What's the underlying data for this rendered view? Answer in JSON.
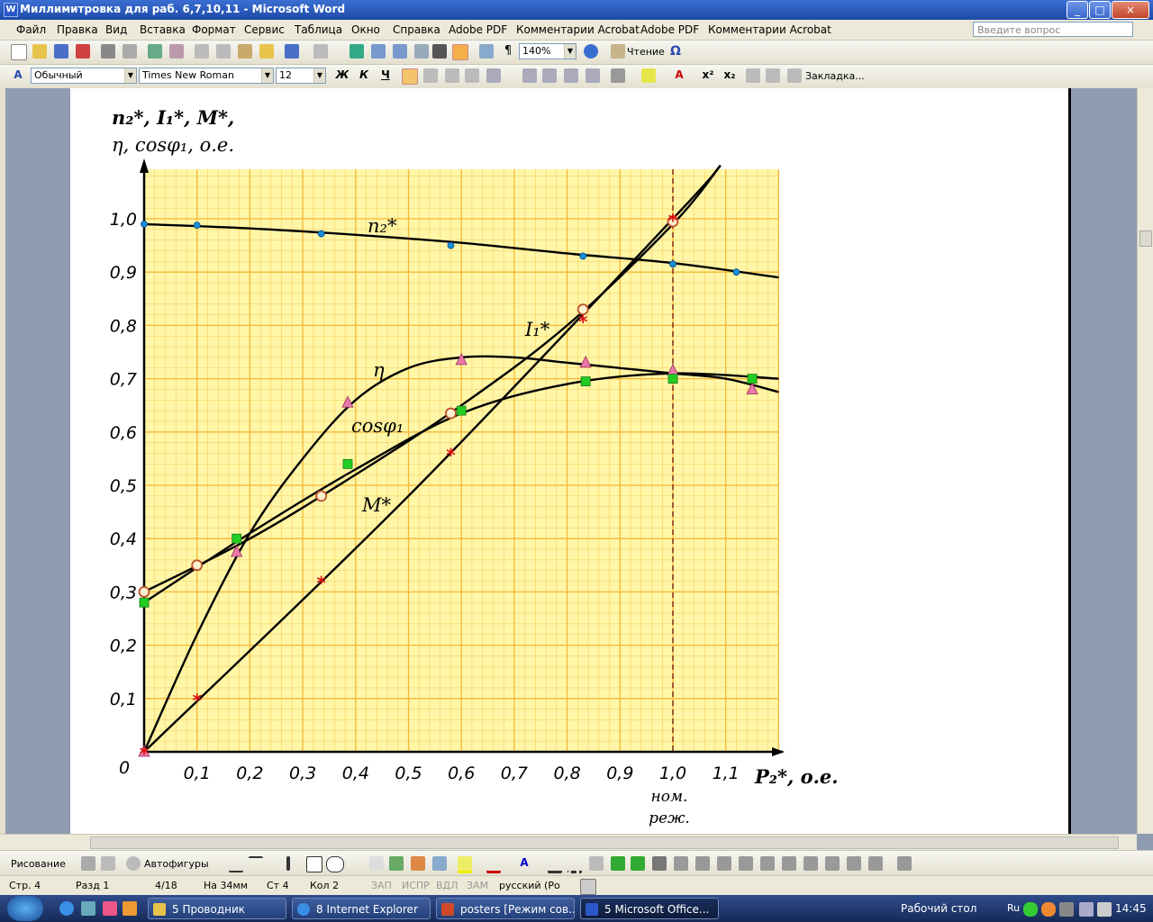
{
  "window": {
    "title": "Миллимитровка для раб. 6,7,10,11 - Microsoft Word",
    "minimize": "_",
    "maximize": "□",
    "close": "×"
  },
  "menu": {
    "items": [
      "Файл",
      "Правка",
      "Вид",
      "Вставка",
      "Формат",
      "Сервис",
      "Таблица",
      "Окно",
      "Справка",
      "Adobe PDF",
      "Комментарии Acrobat",
      "Adobe PDF",
      "Комментарии Acrobat"
    ],
    "help_placeholder": "Введите вопрос"
  },
  "standard_toolbar": {
    "zoom": "140%",
    "reading_label": "Чтение"
  },
  "format_toolbar": {
    "style": "Обычный",
    "font": "Times New Roman",
    "size": "12",
    "bold": "Ж",
    "italic": "К",
    "underline": "Ч",
    "bookmark_label": "Закладка..."
  },
  "chart_data": {
    "type": "line",
    "ylabel_line1": "n₂*, I₁*, M*,",
    "ylabel_line2": "η, cosφ₁, о.е.",
    "xlabel": "P₂*, о.е.",
    "xlim": [
      0,
      1.2
    ],
    "ylim": [
      0,
      1.1
    ],
    "x_ticks": [
      "0,1",
      "0,2",
      "0,3",
      "0,4",
      "0,5",
      "0,6",
      "0,7",
      "0,8",
      "0,9",
      "1,0",
      "1,1"
    ],
    "y_ticks": [
      "0,1",
      "0,2",
      "0,3",
      "0,4",
      "0,5",
      "0,6",
      "0,7",
      "0,8",
      "0,9",
      "1,0"
    ],
    "origin_label": "0",
    "nominal_x": 1.0,
    "nominal_label_1": "ном.",
    "nominal_label_2": "реж.",
    "grid": true,
    "grid_color": "#f5b833",
    "background": "#fff6a8",
    "series": [
      {
        "name": "n₂*",
        "marker": "circle",
        "color": "#1a8fd8",
        "x": [
          0,
          0.1,
          0.335,
          0.58,
          0.83,
          1.0,
          1.12
        ],
        "y": [
          0.99,
          0.988,
          0.972,
          0.95,
          0.93,
          0.915,
          0.9
        ],
        "curve_x": [
          0,
          0.2,
          0.4,
          0.6,
          0.8,
          1.0,
          1.2
        ],
        "curve_y": [
          0.99,
          0.982,
          0.97,
          0.955,
          0.935,
          0.917,
          0.89
        ]
      },
      {
        "name": "I₁*",
        "marker": "open-circle",
        "color": "#c0502a",
        "x": [
          0,
          0.1,
          0.335,
          0.58,
          0.83,
          1.0
        ],
        "y": [
          0.3,
          0.35,
          0.48,
          0.635,
          0.83,
          0.995
        ],
        "curve_x": [
          0,
          0.2,
          0.4,
          0.6,
          0.8,
          1.0,
          1.09
        ],
        "curve_y": [
          0.3,
          0.4,
          0.52,
          0.65,
          0.8,
          0.99,
          1.1
        ]
      },
      {
        "name": "η",
        "marker": "triangle",
        "color": "#e878a8",
        "x": [
          0,
          0.175,
          0.385,
          0.6,
          0.835,
          1.0,
          1.15
        ],
        "y": [
          0,
          0.375,
          0.655,
          0.735,
          0.73,
          0.715,
          0.68
        ],
        "curve_x": [
          0,
          0.1,
          0.2,
          0.3,
          0.4,
          0.5,
          0.6,
          0.7,
          0.8,
          0.9,
          1.0,
          1.1,
          1.2
        ],
        "curve_y": [
          0,
          0.22,
          0.41,
          0.55,
          0.66,
          0.72,
          0.74,
          0.74,
          0.73,
          0.72,
          0.71,
          0.7,
          0.675
        ]
      },
      {
        "name": "cosφ₁",
        "marker": "square",
        "color": "#22cc22",
        "x": [
          0,
          0.175,
          0.385,
          0.6,
          0.835,
          1.0,
          1.15
        ],
        "y": [
          0.28,
          0.4,
          0.54,
          0.64,
          0.695,
          0.7,
          0.7
        ],
        "curve_x": [
          0,
          0.2,
          0.4,
          0.6,
          0.8,
          1.0,
          1.2
        ],
        "curve_y": [
          0.28,
          0.41,
          0.53,
          0.635,
          0.69,
          0.71,
          0.7
        ]
      },
      {
        "name": "M*",
        "marker": "star",
        "color": "#dd1111",
        "x": [
          0,
          0.1,
          0.335,
          0.58,
          0.83,
          1.0
        ],
        "y": [
          0,
          0.1,
          0.32,
          0.56,
          0.81,
          1.0
        ],
        "curve_x": [
          0,
          0.5,
          1.0,
          1.09
        ],
        "curve_y": [
          0,
          0.48,
          1.0,
          1.1
        ]
      }
    ]
  },
  "draw_toolbar": {
    "drawing": "Рисование",
    "autoshapes": "Автофигуры"
  },
  "status": {
    "page": "Стр. 4",
    "section": "Разд 1",
    "pages": "4/18",
    "at": "На 34мм",
    "line": "Ст 4",
    "col": "Кол 2",
    "rec": "ЗАП",
    "trk": "ИСПР",
    "ext": "ВДЛ",
    "ovr": "ЗАМ",
    "lang": "русский (Ро"
  },
  "taskbar": {
    "tasks": [
      "5 Проводник",
      "8 Internet Explorer",
      "posters [Режим сов...",
      "5 Microsoft Office..."
    ],
    "desktop_label": "Рабочий стол",
    "lang": "Ru",
    "clock": "14:45"
  }
}
